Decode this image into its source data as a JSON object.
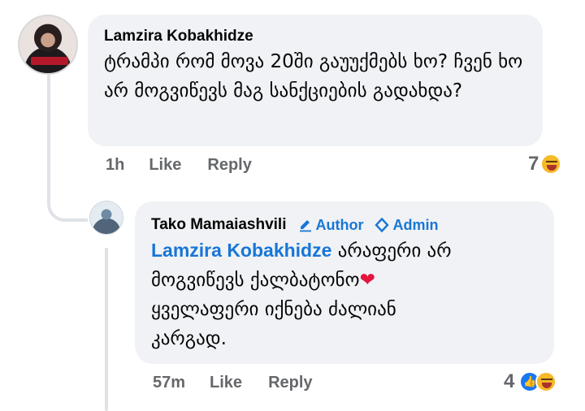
{
  "comment": {
    "author": "Lamzira Kobakhidze",
    "text": "ტრამპი რომ მოვა 20ში გაუუქმებს ხო? ჩვენ ხო არ მოგვიწევს მაგ სანქციების გადახდა?",
    "time": "1h",
    "like_label": "Like",
    "reply_label": "Reply",
    "reaction_count": "7",
    "reactions": [
      "haha-icon"
    ]
  },
  "reply": {
    "author": "Tako Mamaiashvili",
    "author_badge": "Author",
    "admin_badge": "Admin",
    "mention": "Lamzira Kobakhidze",
    "text_line1": "არაფერი არ",
    "text_line2": "მოგვიწევს ქალბატონო",
    "text_line3": "ყველაფერი იქნება ძალიან",
    "text_line4": "კარგად.",
    "heart": "❤",
    "time": "57m",
    "like_label": "Like",
    "reply_label": "Reply",
    "reaction_count": "4",
    "reactions": [
      "like-icon",
      "haha-icon"
    ]
  },
  "colors": {
    "bubble": "#f0f2f5",
    "accent": "#1876d6",
    "muted": "#65676b"
  }
}
